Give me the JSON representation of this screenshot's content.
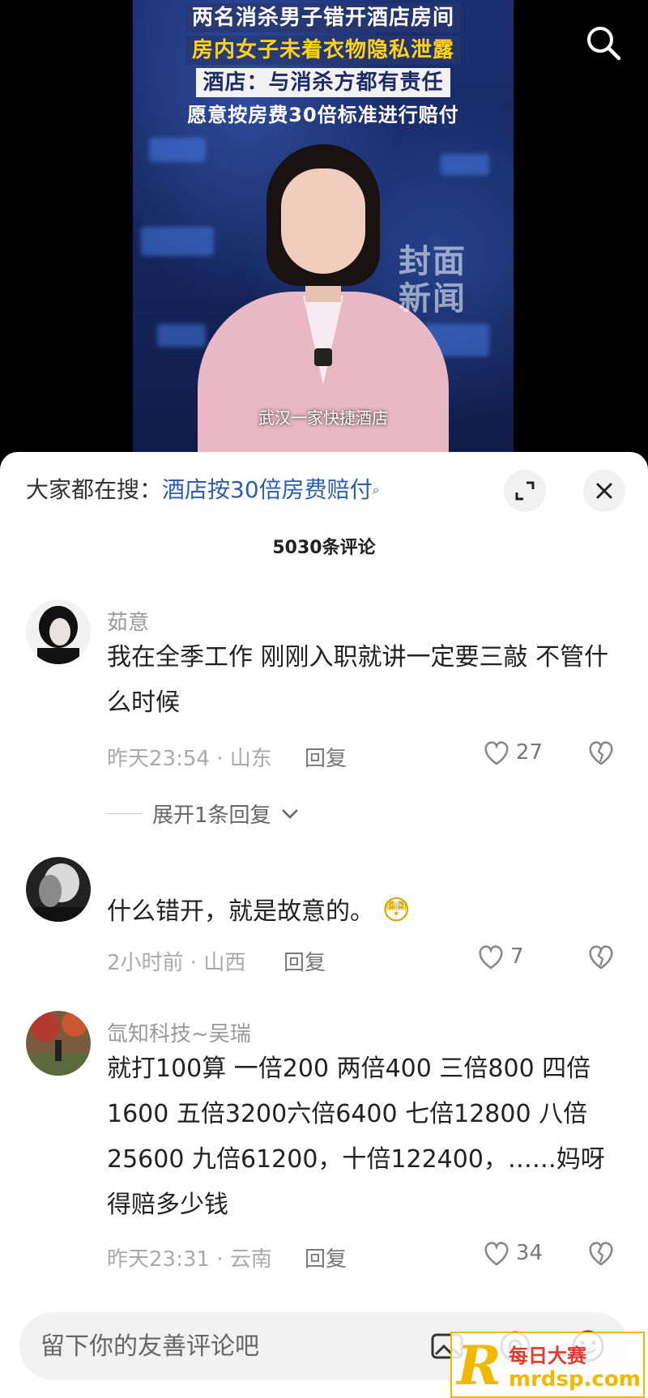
{
  "video": {
    "headlines": [
      "两名消杀男子错开酒店房间",
      "房内女子未着衣物隐私泄露",
      "酒店：与消杀方都有责任",
      "愿意按房费30倍标准进行赔付"
    ],
    "watermark": "封面\n新闻",
    "caption": "武汉一家快捷酒店",
    "search_icon": "search-icon"
  },
  "comments_panel": {
    "trending_prefix": "大家都在搜：",
    "trending_query": "酒店按30倍房费赔付",
    "comment_count": "5030条评论",
    "comments": [
      {
        "username": "茹意",
        "text": "我在全季工作 刚刚入职就讲一定要三敲 不管什么时候",
        "time_location": "昨天23:54 · 山东",
        "reply_label": "回复",
        "likes": "27",
        "expand_replies": "展开1条回复"
      },
      {
        "username": "",
        "text": "什么错开，就是故意的。",
        "emoji": "😳",
        "time_location": "2小时前 · 山西",
        "reply_label": "回复",
        "likes": "7"
      },
      {
        "username": "氙知科技~吴瑞",
        "text": "就打100算 一倍200 两倍400 三倍800 四倍1600 五倍3200六倍6400 七倍12800 八倍25600 九倍61200，十倍122400，……妈呀得赔多少钱",
        "time_location": "昨天23:31 · 云南",
        "reply_label": "回复",
        "likes": "34"
      }
    ]
  },
  "input_bar": {
    "placeholder": "留下你的友善评论吧",
    "icons": [
      "image-icon",
      "at-icon",
      "emoji-icon"
    ]
  },
  "watermark_logo": {
    "letter": "R",
    "line1": "每日大赛",
    "line2": "mrdsp.com"
  }
}
